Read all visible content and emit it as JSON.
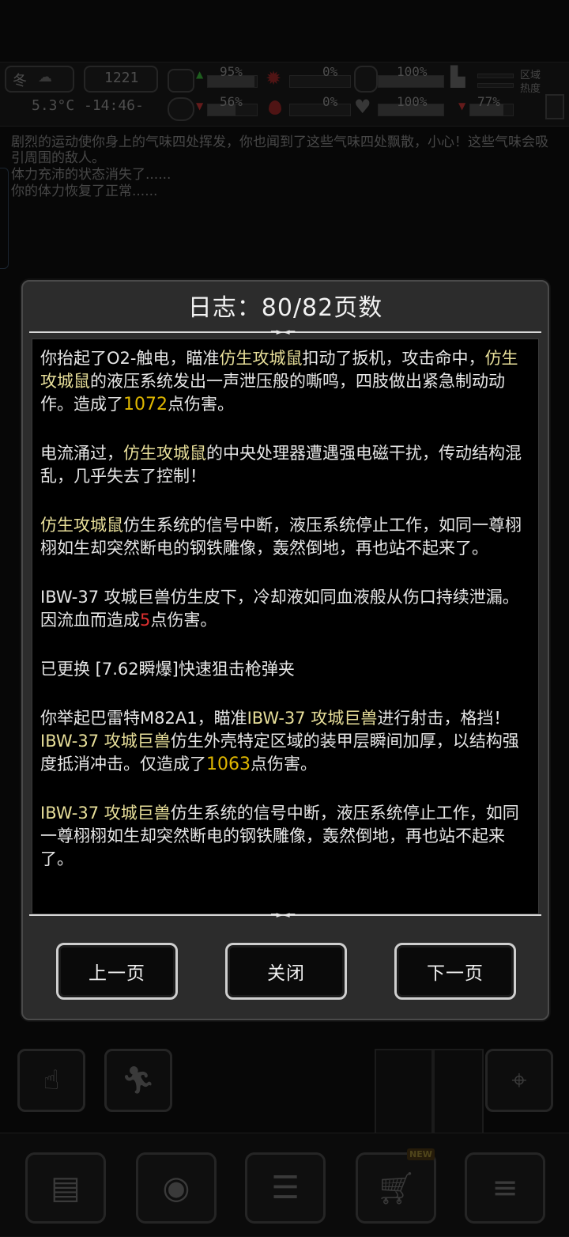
{
  "statusbar": {
    "season": "冬",
    "temperature": "5.3°C",
    "day": "1221",
    "time": "-14:46-",
    "health_pct": "95%",
    "brain_pct": "56%",
    "infection_pct": "0%",
    "bleed_pct": "0%",
    "stamina_pct": "100%",
    "heart_pct": "100%",
    "boot_pct": "77%",
    "region_heat_label": "区域热度"
  },
  "background_log": [
    "剧烈的运动使你身上的气味四处挥发，你也闻到了这些气味四处飘散，小心！这些气味会吸引周围的敌人。",
    "体力充沛的状态消失了......",
    "你的体力恢复了正常......"
  ],
  "dialog": {
    "title": "日志：80/82页数",
    "entries": [
      {
        "segments": [
          {
            "t": "你抬起了O2-触电，瞄准",
            "s": "n"
          },
          {
            "t": "仿生攻城鼠",
            "s": "y"
          },
          {
            "t": "扣动了扳机，攻击命中，",
            "s": "n"
          },
          {
            "t": "仿生攻城鼠",
            "s": "y"
          },
          {
            "t": "的液压系统发出一声泄压般的嘶鸣，四肢做出紧急制动动作。造成了",
            "s": "n"
          },
          {
            "t": "1072",
            "s": "dmg"
          },
          {
            "t": "点伤害。",
            "s": "n"
          }
        ]
      },
      {
        "segments": [
          {
            "t": "电流涌过，",
            "s": "n"
          },
          {
            "t": "仿生攻城鼠",
            "s": "y"
          },
          {
            "t": "的中央处理器遭遇强电磁干扰，传动结构混乱，几乎失去了控制！",
            "s": "n"
          }
        ]
      },
      {
        "segments": [
          {
            "t": "仿生攻城鼠",
            "s": "y"
          },
          {
            "t": "仿生系统的信号中断，液压系统停止工作，如同一尊栩栩如生却突然断电的钢铁雕像，轰然倒地，再也站不起来了。",
            "s": "n"
          }
        ]
      },
      {
        "segments": [
          {
            "t": "IBW-37 攻城巨兽",
            "s": "n"
          },
          {
            "t": "仿生皮下，冷却液如同血液般从伤口持续泄漏。因流血而造成",
            "s": "n"
          },
          {
            "t": "5",
            "s": "red"
          },
          {
            "t": "点伤害。",
            "s": "n"
          }
        ]
      },
      {
        "segments": [
          {
            "t": "已更换 [7.62瞬爆]快速狙击枪弹夹",
            "s": "n"
          }
        ]
      },
      {
        "segments": [
          {
            "t": "你举起巴雷特M82A1，瞄准",
            "s": "n"
          },
          {
            "t": "IBW-37 攻城巨兽",
            "s": "y"
          },
          {
            "t": "进行射击，格挡！",
            "s": "n"
          },
          {
            "t": "IBW-37 攻城巨兽",
            "s": "y"
          },
          {
            "t": "仿生外壳特定区域的装甲层瞬间加厚，以结构强度抵消冲击。仅造成了",
            "s": "n"
          },
          {
            "t": "1063",
            "s": "dmg"
          },
          {
            "t": "点伤害。",
            "s": "n"
          }
        ]
      },
      {
        "segments": [
          {
            "t": "IBW-37 攻城巨兽",
            "s": "y"
          },
          {
            "t": "仿生系统的信号中断，液压系统停止工作，如同一尊栩栩如生却突然断电的钢铁雕像，轰然倒地，再也站不起来了。",
            "s": "n"
          }
        ]
      }
    ],
    "buttons": {
      "prev": "上一页",
      "close": "关闭",
      "next": "下一页"
    }
  },
  "bottom_nav": {
    "new_badge": "NEW",
    "icons": [
      "chest-icon",
      "brain-icon",
      "notebook-icon",
      "shop-cart-icon",
      "menu-icon"
    ]
  }
}
